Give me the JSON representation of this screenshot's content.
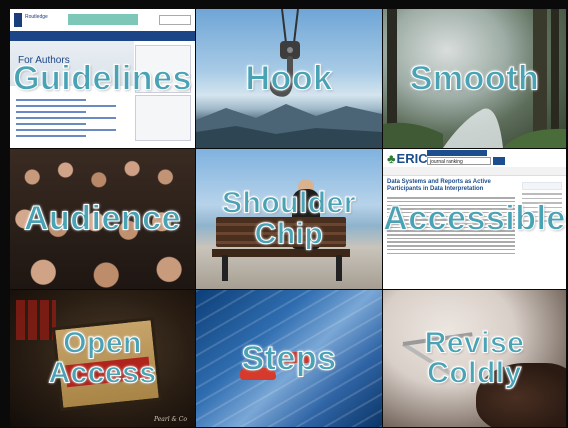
{
  "tiles": [
    {
      "id": "guidelines",
      "label": "Guidelines",
      "website": {
        "header_title": "For Authors",
        "subheading": "Author Publishing Guidelines",
        "nav_items": [
          "Authors",
          "Products",
          "Resources",
          "Help / FAQ",
          "Taylor and Francis"
        ]
      }
    },
    {
      "id": "hook",
      "label": "Hook"
    },
    {
      "id": "smooth",
      "label": "Smooth"
    },
    {
      "id": "audience",
      "label": "Audience"
    },
    {
      "id": "shoulder-chip",
      "label_line1": "Shoulder",
      "label_line2": "Chip"
    },
    {
      "id": "accessible",
      "label": "Accessible",
      "eric_page": {
        "logo": "ERIC",
        "search_value": "journal ranking",
        "result_title": "Data Systems and Reports as Active Participants in Data Interpretation"
      }
    },
    {
      "id": "open-access",
      "label_line1": "Open",
      "label_line2": "Access",
      "watermark": "Pearl & Co"
    },
    {
      "id": "steps",
      "label": "Steps"
    },
    {
      "id": "revise-coldly",
      "label_line1": "Revise",
      "label_line2": "Coldly"
    }
  ],
  "colors": {
    "label_fill": "#4aa3b5",
    "label_outline": "#ffffff",
    "background": "#0a0a0a"
  }
}
